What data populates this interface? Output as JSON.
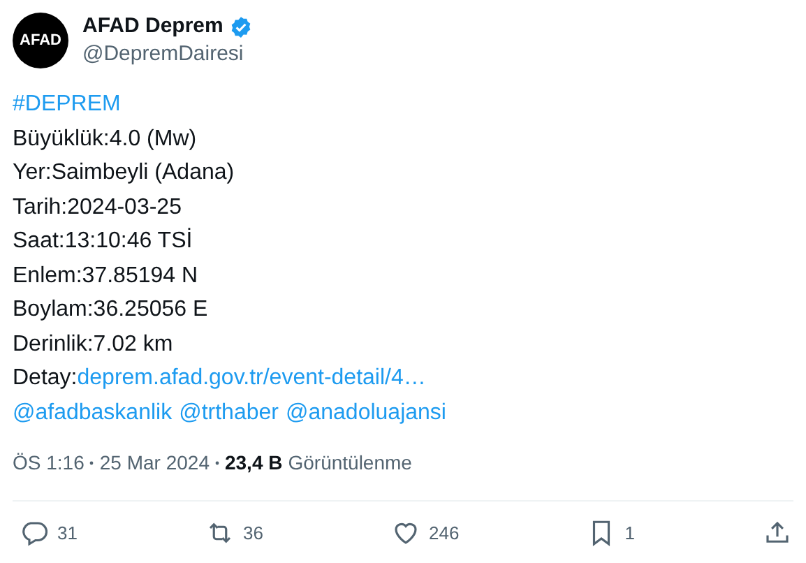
{
  "author": {
    "avatar_text": "AFAD",
    "name": "AFAD Deprem",
    "verified": true,
    "handle": "@DepremDairesi"
  },
  "lines": [
    [
      {
        "kind": "link",
        "text": "#DEPREM"
      }
    ],
    [
      {
        "kind": "text",
        "text": "Büyüklük:4.0 (Mw)"
      }
    ],
    [
      {
        "kind": "text",
        "text": "Yer:Saimbeyli (Adana)"
      }
    ],
    [
      {
        "kind": "text",
        "text": "Tarih:2024-03-25"
      }
    ],
    [
      {
        "kind": "text",
        "text": "Saat:13:10:46 TSİ"
      }
    ],
    [
      {
        "kind": "text",
        "text": "Enlem:37.85194 N"
      }
    ],
    [
      {
        "kind": "text",
        "text": "Boylam:36.25056 E"
      }
    ],
    [
      {
        "kind": "text",
        "text": "Derinlik:7.02 km"
      }
    ],
    [
      {
        "kind": "text",
        "text": "Detay:"
      },
      {
        "kind": "link",
        "text": "deprem.afad.gov.tr/event-detail/4…"
      }
    ],
    [
      {
        "kind": "link",
        "text": "@afadbaskanlik"
      },
      {
        "kind": "link",
        "text": "@trthaber"
      },
      {
        "kind": "link",
        "text": "@anadoluajansi"
      }
    ]
  ],
  "meta": {
    "time": "ÖS 1:16",
    "date": "25 Mar 2024",
    "views_count": "23,4 B",
    "views_label": "Görüntülenme"
  },
  "actions": [
    {
      "kind": "reply",
      "count": "31"
    },
    {
      "kind": "repost",
      "count": "36"
    },
    {
      "kind": "like",
      "count": "246"
    },
    {
      "kind": "bookmark",
      "count": "1"
    },
    {
      "kind": "share"
    }
  ]
}
